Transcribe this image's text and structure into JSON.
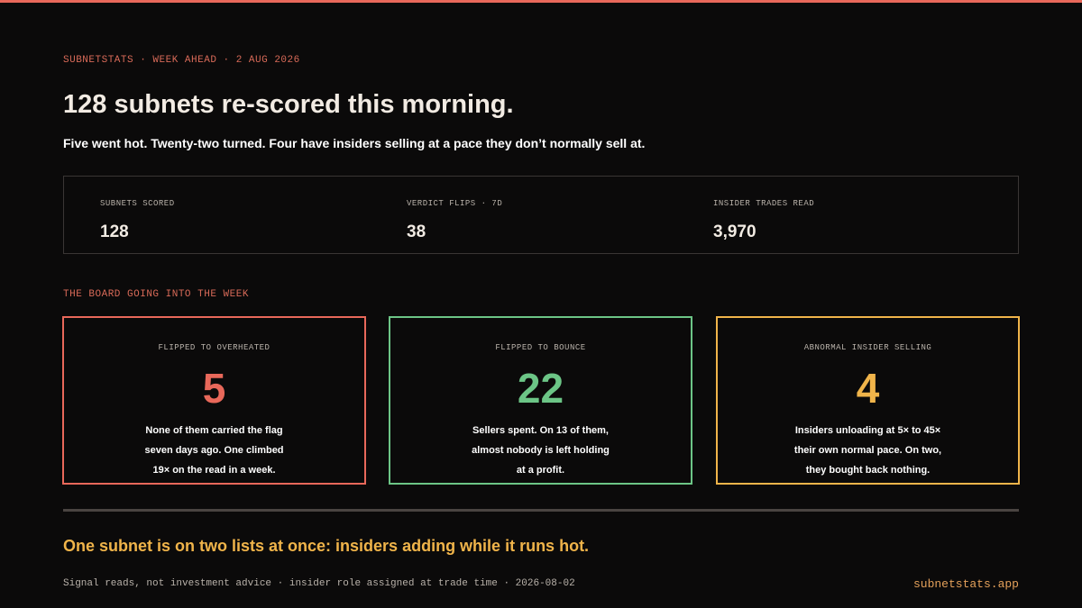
{
  "kicker": "SUBNETSTATS · WEEK AHEAD · 2 AUG 2026",
  "headline": "128 subnets re-scored this morning.",
  "subhead": "Five went hot. Twenty-two turned. Four have insiders selling at a pace they don’t normally sell at.",
  "stats": [
    {
      "label": "SUBNETS SCORED",
      "value": "128"
    },
    {
      "label": "VERDICT FLIPS · 7D",
      "value": "38"
    },
    {
      "label": "INSIDER TRADES READ",
      "value": "3,970"
    }
  ],
  "section_label": "THE BOARD GOING INTO THE WEEK",
  "cards": [
    {
      "label": "FLIPPED TO OVERHEATED",
      "number": "5",
      "color": "#e8685a",
      "lines": [
        "None of them carried the flag",
        "seven days ago. One climbed",
        "19× on the read in a week."
      ]
    },
    {
      "label": "FLIPPED TO BOUNCE",
      "number": "22",
      "color": "#6cc586",
      "lines": [
        "Sellers spent. On 13 of them,",
        "almost nobody is left holding",
        "at a profit."
      ]
    },
    {
      "label": "ABNORMAL INSIDER SELLING",
      "number": "4",
      "color": "#f0b44a",
      "lines": [
        "Insiders unloading at 5× to 45×",
        "their own normal pace. On two,",
        "they bought back nothing."
      ]
    }
  ],
  "callout": "One subnet is on two lists at once: insiders adding while it runs hot.",
  "footnote": "Signal reads, not investment advice · insider role assigned at trade time · 2026-08-02",
  "site": "subnetstats.app",
  "colors": {
    "accent": "#e8685a",
    "background": "#0b0a0a",
    "callout": "#f0b44a",
    "link": "#e3a05a"
  }
}
